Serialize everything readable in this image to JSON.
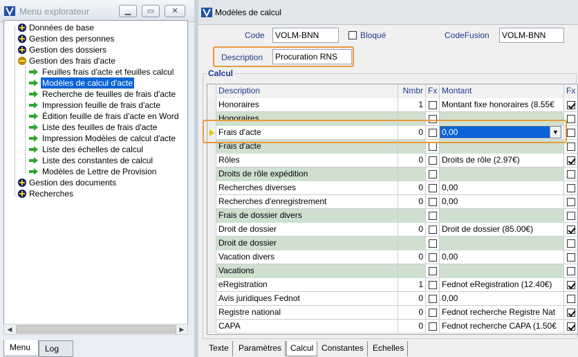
{
  "explorer": {
    "title": "Menu explorateur",
    "tree": {
      "roots": [
        {
          "label": "Données de base",
          "icon": "plus-icon"
        },
        {
          "label": "Gestion des personnes",
          "icon": "plus-icon"
        },
        {
          "label": "Gestion des dossiers",
          "icon": "plus-icon"
        },
        {
          "label": "Gestion des frais d'acte",
          "icon": "minus-icon"
        }
      ],
      "children": [
        {
          "label": "Feuilles frais d'acte et feuilles calcul"
        },
        {
          "label": "Modèles de calcul d'acte",
          "selected": true
        },
        {
          "label": "Recherche de feuilles de frais d'acte"
        },
        {
          "label": "Impression feuille de frais d'acte"
        },
        {
          "label": "Édition feuille de frais d'acte en Word"
        },
        {
          "label": "Liste des feuilles de frais d'acte"
        },
        {
          "label": "Impression Modèles de calcul d'acte"
        },
        {
          "label": "Liste des échelles de calcul"
        },
        {
          "label": "Liste des constantes de calcul"
        },
        {
          "label": "Modèles de Lettre de Provision"
        }
      ],
      "tail_roots": [
        {
          "label": "Gestion des documents",
          "icon": "plus-icon"
        },
        {
          "label": "Recherches",
          "icon": "plus-icon"
        }
      ]
    },
    "tabs": {
      "menu": "Menu",
      "log": "Log"
    }
  },
  "form": {
    "title": "Modèles de calcul",
    "code_label": "Code",
    "code_value": "VOLM-BNN",
    "bloque_label": "Bloqué",
    "codefusion_label": "CodeFusion",
    "codefusion_value": "VOLM-BNN",
    "description_label": "Description",
    "description_value": "Procuration RNS",
    "group_title": "Calcul"
  },
  "grid": {
    "headers": {
      "description": "Description",
      "nmbr": "Nmbr",
      "fx": "Fx",
      "montant": "Montant",
      "fx2": "Fx"
    },
    "rows": [
      {
        "description": "Honoraires",
        "nmbr": "1",
        "fx": false,
        "montant": "Montant fixe honoraires (8.55€",
        "fx2": true,
        "section": false
      },
      {
        "description": "Honoraires",
        "nmbr": "",
        "fx": false,
        "montant": "",
        "fx2": false,
        "section": true
      },
      {
        "description": "Frais d'acte",
        "nmbr": "0",
        "fx": false,
        "montant": "0,00",
        "fx2": false,
        "section": false,
        "current": true
      },
      {
        "description": "Frais d'acte",
        "nmbr": "",
        "fx": false,
        "montant": "",
        "fx2": false,
        "section": true
      },
      {
        "description": "Rôles",
        "nmbr": "0",
        "fx": false,
        "montant": "Droits de rôle (2.97€)",
        "fx2": true,
        "section": false
      },
      {
        "description": "Droits de rôle expédition",
        "nmbr": "",
        "fx": false,
        "montant": "",
        "fx2": false,
        "section": true
      },
      {
        "description": "Recherches diverses",
        "nmbr": "0",
        "fx": false,
        "montant": "0,00",
        "fx2": false,
        "section": false
      },
      {
        "description": "Recherches d'enregistrement",
        "nmbr": "0",
        "fx": false,
        "montant": "0,00",
        "fx2": false,
        "section": false
      },
      {
        "description": "Frais de dossier divers",
        "nmbr": "",
        "fx": false,
        "montant": "",
        "fx2": false,
        "section": true
      },
      {
        "description": "Droit de dossier",
        "nmbr": "0",
        "fx": false,
        "montant": "Droit de dossier (85.00€)",
        "fx2": true,
        "section": false
      },
      {
        "description": "Droit de dossier",
        "nmbr": "",
        "fx": false,
        "montant": "",
        "fx2": false,
        "section": true
      },
      {
        "description": "Vacation divers",
        "nmbr": "0",
        "fx": false,
        "montant": "0,00",
        "fx2": false,
        "section": false
      },
      {
        "description": "Vacations",
        "nmbr": "",
        "fx": false,
        "montant": "",
        "fx2": false,
        "section": true
      },
      {
        "description": "eRegistration",
        "nmbr": "1",
        "fx": false,
        "montant": "Fednot eRegistration (12.40€)",
        "fx2": true,
        "section": false
      },
      {
        "description": "Avis juridiques Fednot",
        "nmbr": "0",
        "fx": false,
        "montant": "0,00",
        "fx2": false,
        "section": false
      },
      {
        "description": "Registre national",
        "nmbr": "0",
        "fx": false,
        "montant": "Fednot recherche Registre Nat",
        "fx2": true,
        "section": false
      },
      {
        "description": "CAPA",
        "nmbr": "0",
        "fx": false,
        "montant": "Fednot recherche CAPA (1.50€",
        "fx2": true,
        "section": false
      }
    ]
  },
  "bottom_tabs": [
    "Texte",
    "Paramètres",
    "Calcul",
    "Constantes",
    "Echelles"
  ],
  "active_bottom_tab": "Calcul",
  "colors": {
    "selection": "#0a63d8",
    "section_row": "#cfe0cf",
    "highlight": "#e89a3c",
    "label": "#1e3a8a",
    "tree_arrow": "#2ea52e"
  }
}
